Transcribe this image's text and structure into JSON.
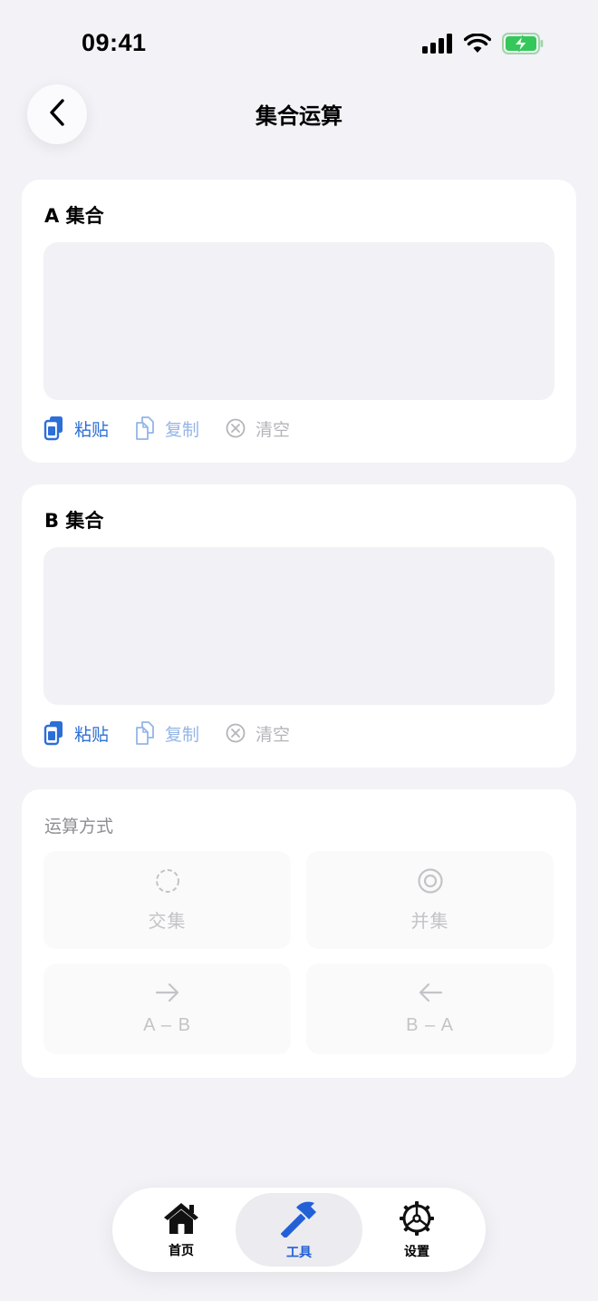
{
  "status_bar": {
    "time": "09:41"
  },
  "header": {
    "title": "集合运算"
  },
  "set_a": {
    "title": "A 集合",
    "value": "",
    "actions": {
      "paste": "粘贴",
      "copy": "复制",
      "clear": "清空"
    }
  },
  "set_b": {
    "title": "B 集合",
    "value": "",
    "actions": {
      "paste": "粘贴",
      "copy": "复制",
      "clear": "清空"
    }
  },
  "operations": {
    "label": "运算方式",
    "items": [
      {
        "label": "交集",
        "icon": "dashed-circle-icon"
      },
      {
        "label": "并集",
        "icon": "concentric-circle-icon"
      },
      {
        "label": "A – B",
        "icon": "arrow-right-icon"
      },
      {
        "label": "B – A",
        "icon": "arrow-left-icon"
      }
    ]
  },
  "tab_bar": {
    "items": [
      {
        "label": "首页",
        "icon": "house-icon",
        "active": false
      },
      {
        "label": "工具",
        "icon": "hammer-icon",
        "active": true
      },
      {
        "label": "设置",
        "icon": "gear-icon",
        "active": false
      }
    ]
  },
  "colors": {
    "accent": "#2260d6",
    "paste": "#2d6fd6",
    "copy": "#94b5e6",
    "muted": "#b5b5ba",
    "background": "#f2f2f7",
    "battery": "#34c759"
  }
}
